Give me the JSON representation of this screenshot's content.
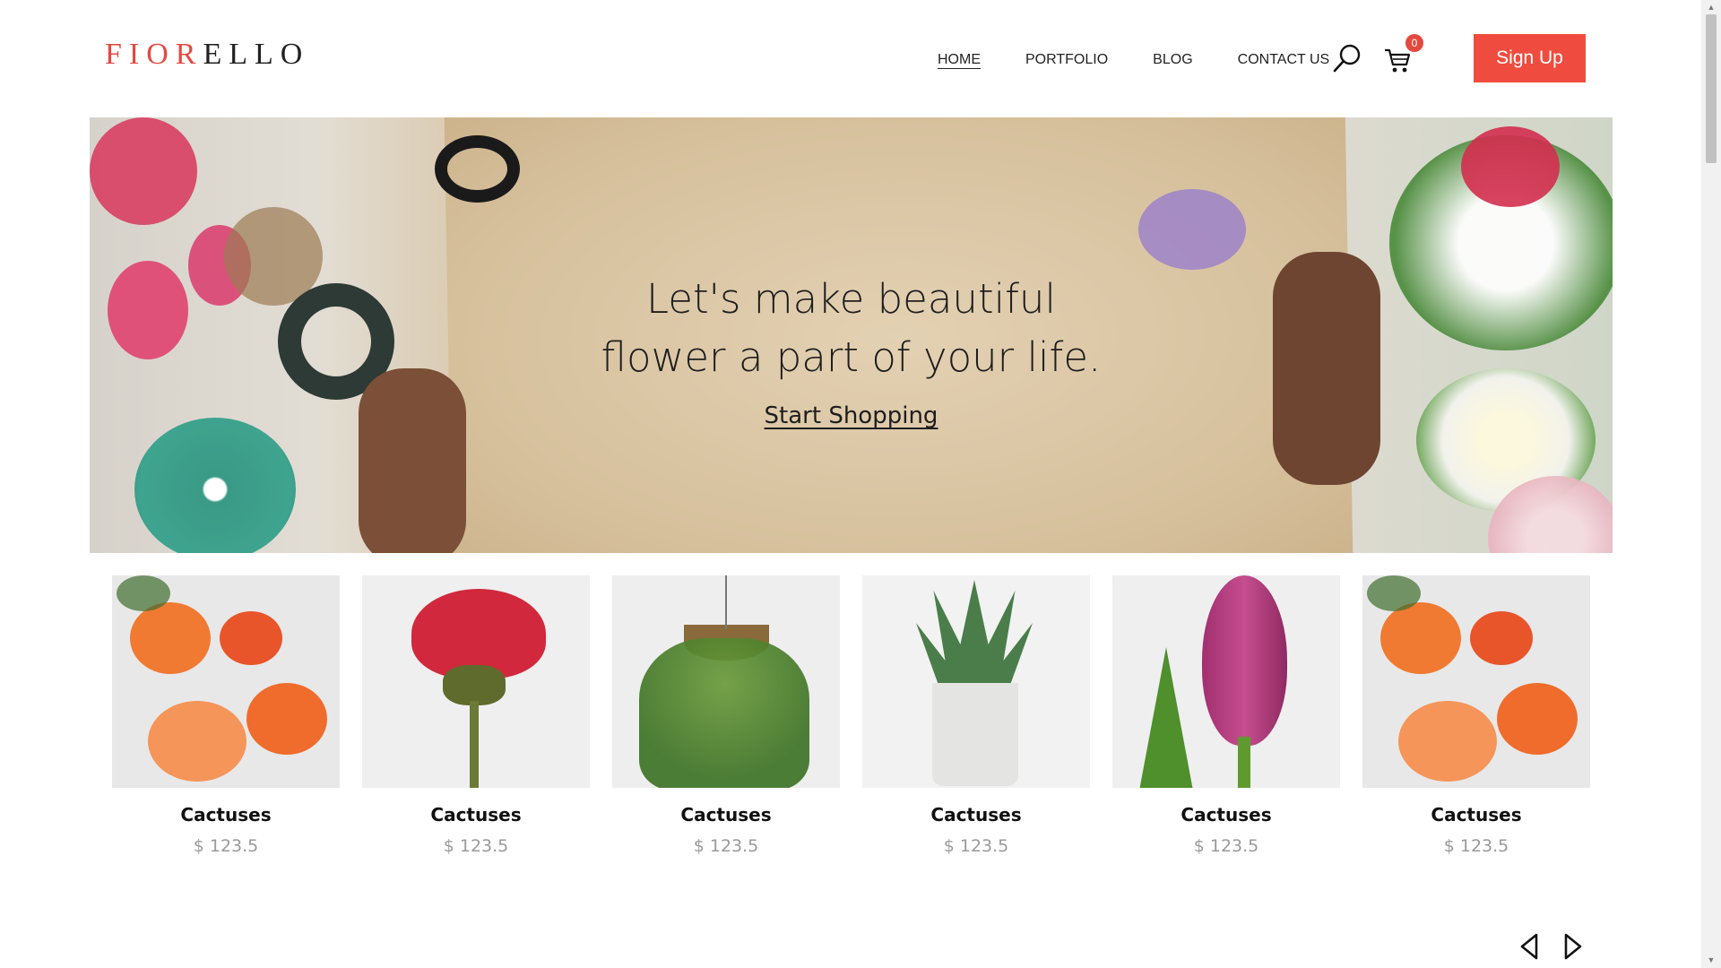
{
  "brand": {
    "logo_accent": "FIOR",
    "logo_rest": "ELLO",
    "accent_color": "#e4493f"
  },
  "nav": {
    "items": [
      {
        "label": "HOME",
        "active": true
      },
      {
        "label": "PORTFOLIO",
        "active": false
      },
      {
        "label": "BLOG",
        "active": false
      },
      {
        "label": "CONTACT US",
        "active": false
      }
    ]
  },
  "header": {
    "cart_count": "0",
    "signup_label": "Sign Up",
    "search_icon": "search-icon",
    "cart_icon": "cart-icon"
  },
  "hero": {
    "title_line1": "Let's make beautiful",
    "title_line2": "flower a part of your life.",
    "cta": "Start Shopping"
  },
  "products": [
    {
      "name": "Cactuses",
      "price": "$ 123.5",
      "image": "orange-roses"
    },
    {
      "name": "Cactuses",
      "price": "$ 123.5",
      "image": "red-rose"
    },
    {
      "name": "Cactuses",
      "price": "$ 123.5",
      "image": "hanging-fern"
    },
    {
      "name": "Cactuses",
      "price": "$ 123.5",
      "image": "aloe-pot"
    },
    {
      "name": "Cactuses",
      "price": "$ 123.5",
      "image": "pink-tulip"
    },
    {
      "name": "Cactuses",
      "price": "$ 123.5",
      "image": "orange-roses"
    }
  ],
  "carousel": {
    "prev_icon": "chevron-left-icon",
    "next_icon": "chevron-right-icon"
  }
}
